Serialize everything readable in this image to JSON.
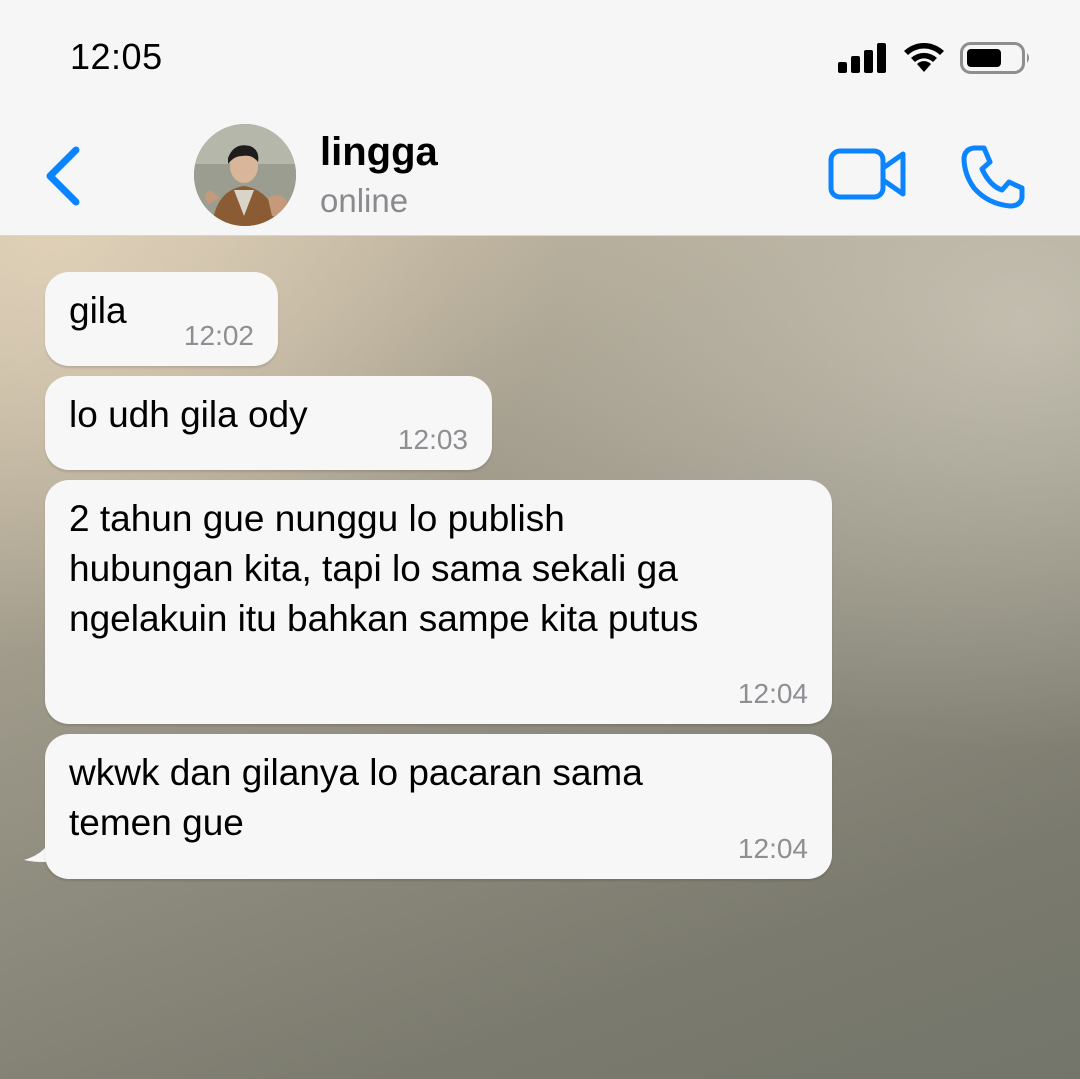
{
  "status_bar": {
    "time": "12:05",
    "icons": [
      "signal-icon",
      "wifi-icon",
      "battery-icon"
    ]
  },
  "header": {
    "contact_name": "lingga",
    "contact_status": "online",
    "accent_color": "#0a84ff"
  },
  "messages": [
    {
      "text": "gila",
      "time": "12:02"
    },
    {
      "text": "lo udh gila ody",
      "time": "12:03"
    },
    {
      "text": "2 tahun gue nunggu lo publish\nhubungan kita, tapi lo sama sekali ga\nngelakuin itu bahkan sampe kita putus",
      "time": "12:04"
    },
    {
      "text": "wkwk dan gilanya lo pacaran sama\ntemen gue",
      "time": "12:04"
    }
  ]
}
